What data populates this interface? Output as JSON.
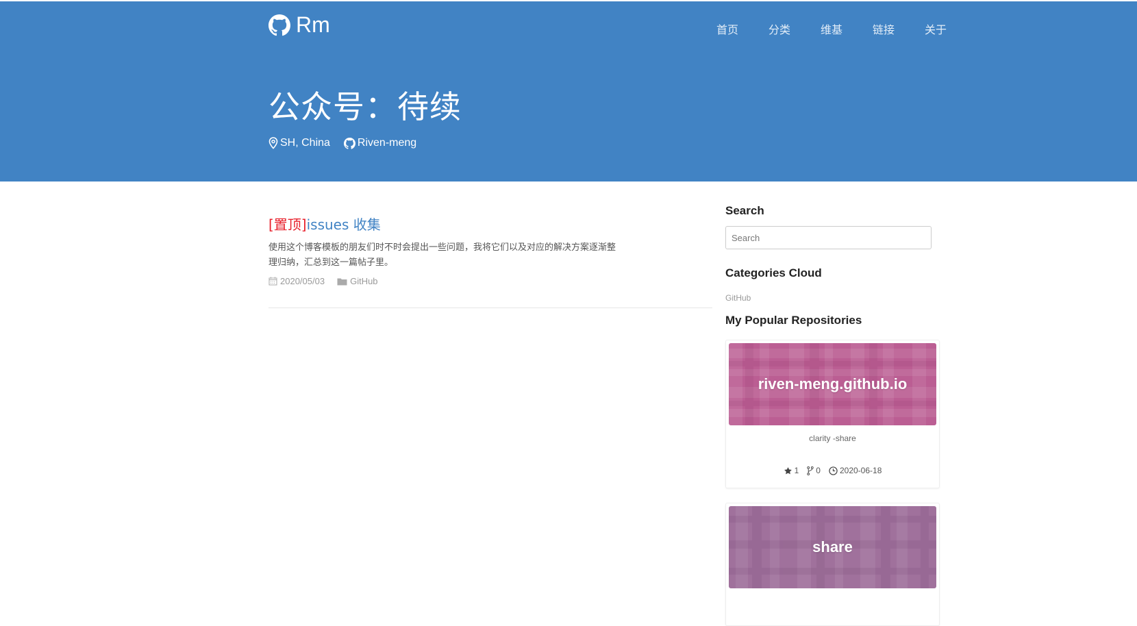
{
  "brand": {
    "name": "Rm",
    "icon": "github-icon"
  },
  "nav": {
    "items": [
      {
        "label": "首页"
      },
      {
        "label": "分类"
      },
      {
        "label": "维基"
      },
      {
        "label": "链接"
      },
      {
        "label": "关于"
      }
    ]
  },
  "hero": {
    "title": "公众号：待续",
    "location": "SH, China",
    "location_icon": "map-pin-icon",
    "github_user": "Riven-meng",
    "github_icon": "github-icon"
  },
  "colors": {
    "banner": "#4183c4",
    "pinned_tag": "#e8222d",
    "link": "#4183c4",
    "repo1_bg": "#bb5e93",
    "repo2_bg": "#a0719c"
  },
  "post": {
    "pinned_tag": "[置顶]",
    "title": "issues 收集",
    "excerpt_line1": "使用这个博客模板的朋友们时不时会提出一些问题，我将它们以及对应的解决方案逐渐整",
    "excerpt_line2": "理归纳，汇总到这一篇帖子里。",
    "date": "2020/05/03",
    "date_icon": "calendar-icon",
    "category": "GitHub",
    "category_icon": "folder-icon"
  },
  "sidebar": {
    "search_title": "Search",
    "search_placeholder": "Search",
    "categories_title": "Categories Cloud",
    "categories": [
      {
        "label": "GitHub"
      }
    ],
    "repos_title": "My Popular Repositories",
    "repos": [
      {
        "name": "riven-meng.github.io",
        "description": "clarity -share",
        "stars": "1",
        "forks": "0",
        "updated": "2020-06-18"
      },
      {
        "name": "share"
      }
    ]
  }
}
